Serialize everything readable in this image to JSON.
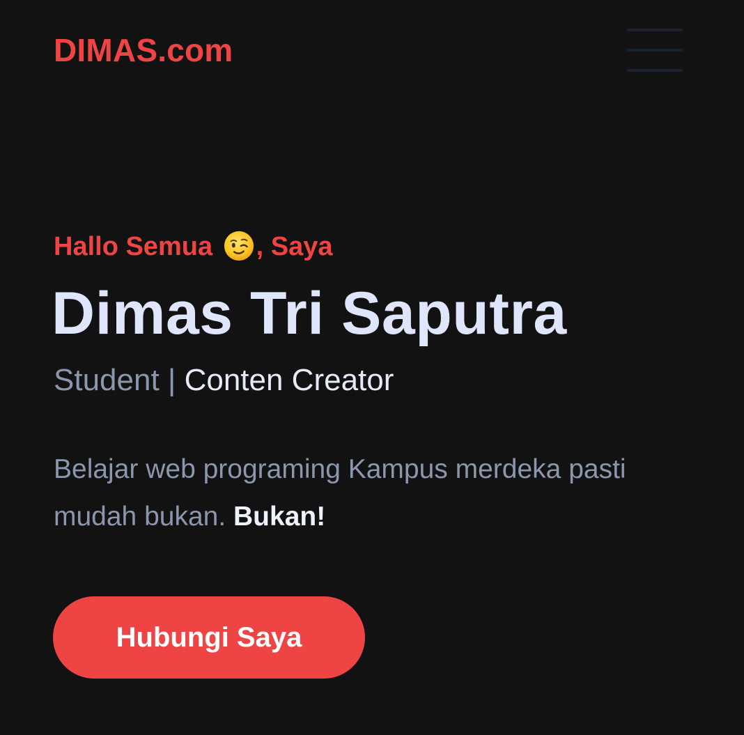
{
  "header": {
    "logo": "DIMAS.com",
    "menu_icon": "hamburger-menu-icon"
  },
  "hero": {
    "greeting_before": "Hallo Semua ",
    "greeting_emoji": "winking-face-emoji",
    "greeting_after": ", Saya",
    "name": "Dimas Tri Saputra",
    "role_primary": "Student",
    "role_separator": " | ",
    "role_secondary": "Conten Creator",
    "description_text": "Belajar web programing Kampus merdeka pasti mudah bukan. ",
    "description_emphasis": "Bukan!",
    "cta_label": "Hubungi Saya"
  },
  "colors": {
    "background": "#121213",
    "accent": "#ef4444",
    "heading": "#dfe6fb",
    "muted": "#8a97ad"
  }
}
